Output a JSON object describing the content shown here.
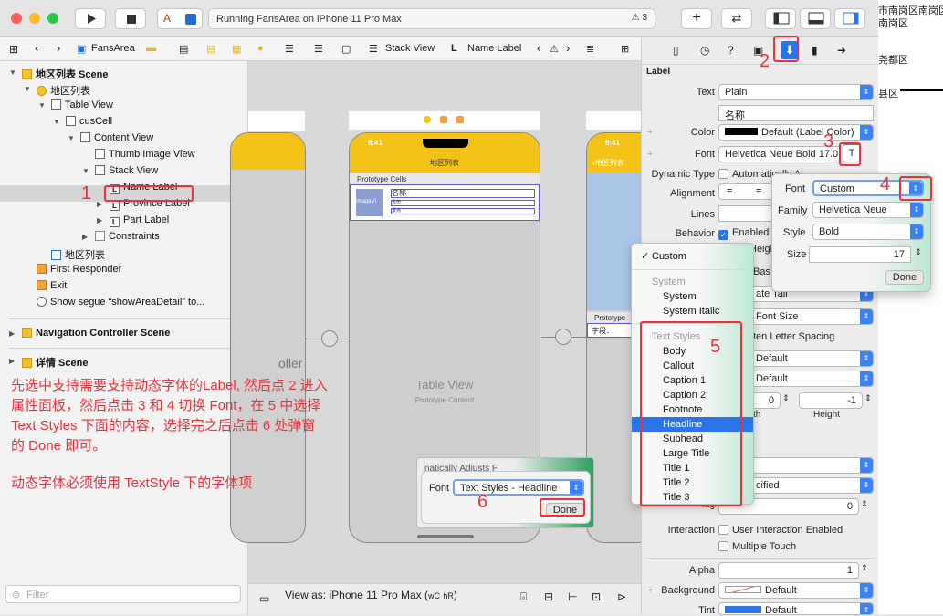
{
  "window": {
    "status": "Running FansArea on iPhone 11 Pro Max",
    "warning_count": "3"
  },
  "jumpbar": {
    "project": "FansArea",
    "stack_view": "Stack View",
    "name_label": "Name Label"
  },
  "navigator": {
    "items": [
      {
        "label": "地区列表 Scene",
        "bold": true
      },
      {
        "label": "地区列表"
      },
      {
        "label": "Table View"
      },
      {
        "label": "cusCell"
      },
      {
        "label": "Content View"
      },
      {
        "label": "Thumb Image View"
      },
      {
        "label": "Stack View"
      },
      {
        "label": "Name Label",
        "selected": true
      },
      {
        "label": "Province Label"
      },
      {
        "label": "Part Label"
      },
      {
        "label": "Constraints"
      },
      {
        "label": "地区列表"
      },
      {
        "label": "First Responder"
      },
      {
        "label": "Exit"
      },
      {
        "label": "Show segue “showAreaDetail” to..."
      },
      {
        "label": "Navigation Controller Scene",
        "bold": true
      },
      {
        "label": "详情 Scene",
        "bold": true
      }
    ],
    "filter_placeholder": "Filter"
  },
  "canvas": {
    "time": "9:41",
    "scene_title": "地区列表",
    "prototype_cells": "Prototype Cells",
    "cell_image": "ImageVi",
    "cell_name": "名称",
    "cell_l2": "省份",
    "cell_l3": "景点",
    "table_view": "Table View",
    "prototype_content": "Prototype Content",
    "left_partial": "oller",
    "right_back": "地区列表",
    "right_proto": "Prototype",
    "right_field": "字段："
  },
  "bottombar": {
    "view_as": "View as: iPhone 11 Pro Max (",
    "wc": "wC",
    "hr": "hR",
    ")": ")"
  },
  "inspector": {
    "section": "Label",
    "text_label": "Text",
    "text_value": "Plain",
    "text_content": "名称",
    "color_label": "Color",
    "color_value": "Default (Label Color)",
    "font_label": "Font",
    "font_value": "Helvetica Neue Bold 17.0",
    "dynamic_type_label": "Dynamic Type",
    "dynamic_type_value": "Automatically Adjusts Font",
    "alignment_label": "Alignment",
    "lines_label": "Lines",
    "behavior_label": "Behavior",
    "behavior_value": "Enabled",
    "height_frag": "Heigh",
    "baseline_frag": "Bas",
    "truncate_frag": "ate Tail",
    "font_size_frag": "Font Size",
    "spacing_frag": "ten Letter Spacing",
    "default1": "Default",
    "default2": "Default",
    "num_zero": "0",
    "num_neg1": "-1",
    "width_frag": "th",
    "height_label": "Height",
    "unspecified_frag": "cified",
    "tag_frag": "Tag",
    "tag_value": "0",
    "interaction_label": "Interaction",
    "interaction_value": "User Interaction Enabled",
    "multiple_touch": "Multiple Touch",
    "alpha_label": "Alpha",
    "alpha_value": "1",
    "background_label": "Background",
    "background_value": "Default",
    "tint_label": "Tint",
    "tint_value": "Default"
  },
  "font_popover": {
    "font_label": "Font",
    "font_value": "Custom",
    "family_label": "Family",
    "family_value": "Helvetica Neue",
    "style_label": "Style",
    "style_value": "Bold",
    "size_label": "Size",
    "size_value": "17",
    "done": "Done"
  },
  "font_menu": {
    "custom": "Custom",
    "system_header": "System",
    "system": "System",
    "system_italic": "System Italic",
    "text_styles_header": "Text Styles",
    "styles": [
      "Body",
      "Callout",
      "Caption 1",
      "Caption 2",
      "Footnote",
      "Headline",
      "Subhead",
      "Large Title",
      "Title 1",
      "Title 2",
      "Title 3"
    ]
  },
  "small_popover": {
    "font_label": "Font",
    "font_value": "Text Styles - Headline",
    "done": "Done",
    "partial": "natically Adjusts F"
  },
  "annotations": {
    "n1": "1",
    "n2": "2",
    "n3": "3",
    "n4": "4",
    "n5": "5",
    "n6": "6",
    "note1_l1": "先选中支持需要支持动态字体的Label, 然后点 2 进入",
    "note1_l2": "属性面板，然后点击 3 和 4 切换 Font，在 5 中选择",
    "note1_l3": " Text Styles 下面的内容，选择完之后点击 6 处弹窗",
    "note1_l4": "的 Done 即可。",
    "note2": "动态字体必须使用 TextStyle 下的字体项"
  },
  "right_edge": {
    "l1": "市南岗区南岗区",
    "l2": "南岗区",
    "l3": "尧都区",
    "l4": "县区"
  }
}
